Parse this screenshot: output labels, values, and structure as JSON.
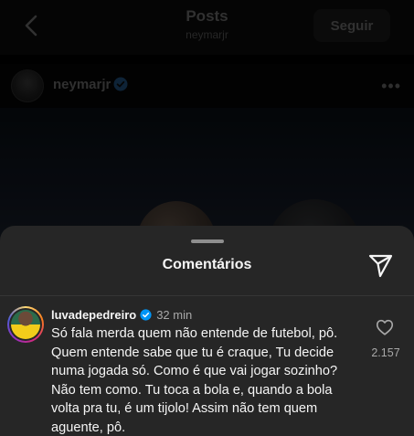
{
  "topbar": {
    "title": "Posts",
    "subtitle": "neymarjr",
    "follow_label": "Seguir"
  },
  "post": {
    "username": "neymarjr"
  },
  "comments_sheet": {
    "title": "Comentários",
    "comments": [
      {
        "username": "luvadepedreiro",
        "time": "32 min",
        "text": "Só fala merda quem não entende de futebol, pô. Quem entende sabe que tu é craque, Tu decide numa jogada só. Como é que vai jogar sozinho? Não tem como. Tu toca a bola e, quando a bola volta pra tu, é um tijolo! Assim não tem quem aguente, pô.",
        "likes": "2.157"
      }
    ]
  },
  "icons": {
    "back": "chevron-left-icon",
    "verified": "verified-badge-icon",
    "more": "more-horizontal-icon",
    "send": "send-icon",
    "like": "heart-icon"
  },
  "colors": {
    "background": "#000000",
    "sheet": "#262626",
    "verified": "#0095f6",
    "text_primary": "#f5f5f5",
    "text_secondary": "#a8a8a8"
  }
}
